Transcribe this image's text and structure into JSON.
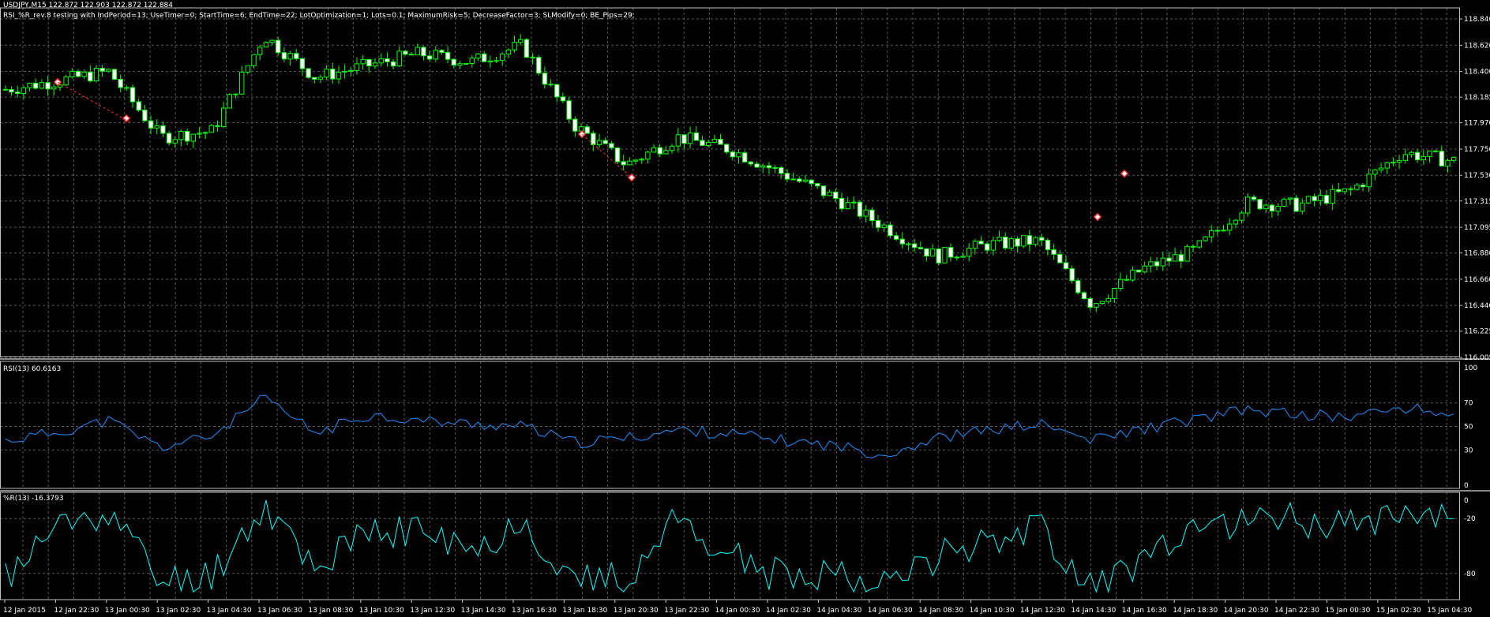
{
  "header": {
    "symbol_line": "USDJPY,M15  122.872 122.903 122.872 122.884",
    "ea_line": "RSI_%R_rev.8 testing with IndPeriod=13; UseTimer=0; StartTime=6; EndTime=22; LotOptimization=1; Lots=0.1; MaximumRisk=5; DecreaseFactor=3; SLModify=0; BE_Pips=29;"
  },
  "colors": {
    "background": "#000000",
    "grid": "#5a5a5a",
    "bull_candle": "#00ff00",
    "bear_candle": "#ffffff",
    "rsi_line": "#1e90ff",
    "wpr_line": "#00ffff",
    "panel_separator": "#c0c0c0"
  },
  "price_panel": {
    "ticks": [
      "118.840",
      "118.620",
      "118.400",
      "118.185",
      "117.970",
      "117.750",
      "117.530",
      "117.315",
      "117.095",
      "116.880",
      "116.660",
      "116.440",
      "116.225",
      "116.005"
    ],
    "ylim": [
      116.005,
      118.84
    ],
    "candle_count": 240
  },
  "rsi_panel": {
    "label": "RSI(13) 60.6163",
    "ticks": [
      "100",
      "70",
      "50",
      "30",
      "0"
    ],
    "ylim": [
      0,
      100
    ]
  },
  "wpr_panel": {
    "label": "%R(13) -16.3793",
    "ticks": [
      "0",
      "-20",
      "-80"
    ],
    "ylim": [
      -100,
      0
    ]
  },
  "time_axis": [
    "12 Jan 2015",
    "12 Jan 22:30",
    "13 Jan 00:30",
    "13 Jan 02:30",
    "13 Jan 04:30",
    "13 Jan 06:30",
    "13 Jan 08:30",
    "13 Jan 10:30",
    "13 Jan 12:30",
    "13 Jan 14:30",
    "13 Jan 16:30",
    "13 Jan 18:30",
    "13 Jan 20:30",
    "13 Jan 22:30",
    "14 Jan 00:30",
    "14 Jan 02:30",
    "14 Jan 04:30",
    "14 Jan 06:30",
    "14 Jan 08:30",
    "14 Jan 10:30",
    "14 Jan 12:30",
    "14 Jan 14:30",
    "14 Jan 16:30",
    "14 Jan 18:30",
    "14 Jan 20:30",
    "14 Jan 22:30",
    "15 Jan 00:30",
    "15 Jan 02:30",
    "15 Jan 04:30"
  ],
  "chart_data": [
    {
      "type": "line",
      "title": "USDJPY,M15",
      "series": [
        {
          "name": "",
          "x": [
            "12 Jan 2015",
            "12 Jan 22:30",
            "13 Jan 00:30",
            "13 Jan 02:30",
            "13 Jan 04:30",
            "13 Jan 06:30",
            "13 Jan 08:30",
            "13 Jan 10:30",
            "13 Jan 12:30",
            "13 Jan 14:30",
            "13 Jan 16:30",
            "13 Jan 18:30",
            "13 Jan 20:30",
            "13 Jan 22:30",
            "14 Jan 00:30",
            "14 Jan 02:30",
            "14 Jan 04:30",
            "14 Jan 06:30",
            "14 Jan 08:30",
            "14 Jan 10:30",
            "14 Jan 12:30",
            "14 Jan 14:30",
            "14 Jan 16:30",
            "14 Jan 18:30",
            "14 Jan 20:30",
            "14 Jan 22:30",
            "15 Jan 00:30",
            "15 Jan 02:30",
            "15 Jan 04:30"
          ],
          "values": [
            118.25,
            118.32,
            118.4,
            117.85,
            117.9,
            118.7,
            118.35,
            118.45,
            118.55,
            118.48,
            118.62,
            117.95,
            117.62,
            117.85,
            117.75,
            117.55,
            117.35,
            117.1,
            116.85,
            116.95,
            116.98,
            116.45,
            116.75,
            116.9,
            117.3,
            117.28,
            117.4,
            117.72,
            117.65
          ]
        }
      ],
      "ylim": [
        116.005,
        118.84
      ]
    },
    {
      "type": "line",
      "title": "RSI(13) 60.6163",
      "series": [
        {
          "name": "",
          "x": [
            "12 Jan 2015",
            "12 Jan 22:30",
            "13 Jan 00:30",
            "13 Jan 02:30",
            "13 Jan 04:30",
            "13 Jan 06:30",
            "13 Jan 08:30",
            "13 Jan 10:30",
            "13 Jan 12:30",
            "13 Jan 14:30",
            "13 Jan 16:30",
            "13 Jan 18:30",
            "13 Jan 20:30",
            "13 Jan 22:30",
            "14 Jan 00:30",
            "14 Jan 02:30",
            "14 Jan 04:30",
            "14 Jan 06:30",
            "14 Jan 08:30",
            "14 Jan 10:30",
            "14 Jan 12:30",
            "14 Jan 14:30",
            "14 Jan 16:30",
            "14 Jan 18:30",
            "14 Jan 20:30",
            "14 Jan 22:30",
            "15 Jan 00:30",
            "15 Jan 02:30",
            "15 Jan 04:30"
          ],
          "values": [
            38,
            45,
            55,
            32,
            42,
            74,
            44,
            60,
            55,
            52,
            50,
            36,
            40,
            47,
            44,
            38,
            34,
            26,
            40,
            47,
            52,
            38,
            48,
            56,
            64,
            60,
            58,
            66,
            60
          ]
        }
      ],
      "ylim": [
        0,
        100
      ]
    },
    {
      "type": "line",
      "title": "%R(13) -16.3793",
      "series": [
        {
          "name": "",
          "x": [
            "12 Jan 2015",
            "12 Jan 22:30",
            "13 Jan 00:30",
            "13 Jan 02:30",
            "13 Jan 04:30",
            "13 Jan 06:30",
            "13 Jan 08:30",
            "13 Jan 10:30",
            "13 Jan 12:30",
            "13 Jan 14:30",
            "13 Jan 16:30",
            "13 Jan 18:30",
            "13 Jan 20:30",
            "13 Jan 22:30",
            "14 Jan 00:30",
            "14 Jan 02:30",
            "14 Jan 04:30",
            "14 Jan 06:30",
            "14 Jan 08:30",
            "14 Jan 10:30",
            "14 Jan 12:30",
            "14 Jan 14:30",
            "14 Jan 16:30",
            "14 Jan 18:30",
            "14 Jan 20:30",
            "14 Jan 22:30",
            "15 Jan 00:30",
            "15 Jan 02:30",
            "15 Jan 04:30"
          ],
          "values": [
            -85,
            -30,
            -10,
            -90,
            -80,
            -5,
            -70,
            -40,
            -30,
            -60,
            -20,
            -90,
            -85,
            -20,
            -60,
            -85,
            -75,
            -95,
            -60,
            -40,
            -30,
            -95,
            -65,
            -40,
            -15,
            -20,
            -30,
            -5,
            -20
          ]
        }
      ],
      "ylim": [
        -100,
        0
      ]
    }
  ]
}
